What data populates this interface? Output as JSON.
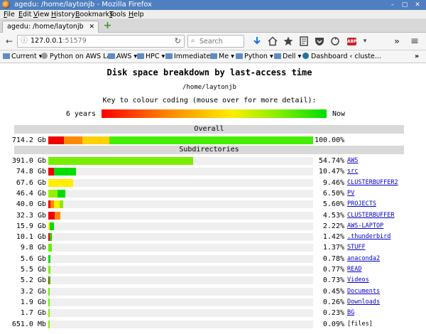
{
  "window": {
    "title": "agedu: /home/laytonjb - Mozilla Firefox",
    "minimize_glyph": "–",
    "maximize_glyph": "▢",
    "close_glyph": "✕"
  },
  "menu": {
    "items": [
      {
        "label": "File",
        "mnemonic": "F",
        "rest": "ile"
      },
      {
        "label": "Edit",
        "mnemonic": "E",
        "rest": "dit"
      },
      {
        "label": "View",
        "mnemonic": "V",
        "rest": "iew"
      },
      {
        "label": "History",
        "mnemonic": "H",
        "rest": "istory"
      },
      {
        "label": "Bookmarks",
        "mnemonic": "B",
        "rest": "ookmarks"
      },
      {
        "label": "Tools",
        "mnemonic": "T",
        "rest": "ools"
      },
      {
        "label": "Help",
        "mnemonic": "H",
        "rest": "elp"
      }
    ]
  },
  "tab": {
    "label": "agedu: /home/laytonjb",
    "close_glyph": "✕",
    "new_tab_glyph": "+"
  },
  "nav": {
    "back_glyph": "←",
    "url_host": "127.0.0.1",
    "url_port": ":51579",
    "reload_glyph": "↻",
    "search_placeholder": "Search",
    "icons": [
      "download-icon",
      "home-icon",
      "star-icon",
      "reader-icon",
      "pocket-icon",
      "sync-icon",
      "adblock-icon",
      "overflow-icon",
      "menu-icon"
    ],
    "abp_label": "ABP",
    "overflow_glyph": "»",
    "menu_glyph": "≡"
  },
  "bookmarks": {
    "items": [
      {
        "label": "Current",
        "type": "folder"
      },
      {
        "label": "Python on AWS La...",
        "type": "link"
      },
      {
        "label": "AWS",
        "type": "folder"
      },
      {
        "label": "HPC",
        "type": "folder"
      },
      {
        "label": "Immediate",
        "type": "folder"
      },
      {
        "label": "Me",
        "type": "folder"
      },
      {
        "label": "Python",
        "type": "folder"
      },
      {
        "label": "Dell",
        "type": "folder"
      },
      {
        "label": "Dashboard ‹ cluste...",
        "type": "link"
      }
    ],
    "overflow_glyph": "»"
  },
  "page": {
    "heading": "Disk space breakdown by last-access time",
    "path": "/home/laytonjb",
    "key_text": "Key to colour coding (mouse over for more detail):",
    "key_old": "6 years",
    "key_now": "Now",
    "overall_label": "Overall",
    "subdirs_label": "Subdirectories",
    "colors": {
      "red": "#ff0000",
      "orange": "#ff8800",
      "yellow": "#ffee00",
      "lime": "#88ee00",
      "green": "#00dd00",
      "link": "#0000cc",
      "section_bg": "#d9d9d9",
      "track_bg": "#efefef"
    },
    "overall": {
      "size": "714.2 Gb",
      "pct": "100.00%",
      "fraction": 1.0,
      "segments": [
        {
          "frac": 0.06,
          "color": "#ee0000"
        },
        {
          "frac": 0.07,
          "color": "#ff8800"
        },
        {
          "frac": 0.1,
          "color": "#ffd000"
        },
        {
          "frac": 0.77,
          "color": "#44ee00"
        }
      ]
    },
    "rows": [
      {
        "size": "391.0 Gb",
        "pct": "54.74%",
        "name": "AWS",
        "link": true,
        "fraction": 0.5474,
        "segments": [
          {
            "frac": 1.0,
            "color": "#77ee00"
          }
        ]
      },
      {
        "size": "74.8 Gb",
        "pct": "10.47%",
        "name": "src",
        "link": true,
        "fraction": 0.1047,
        "segments": [
          {
            "frac": 0.2,
            "color": "#ee0000"
          },
          {
            "frac": 0.8,
            "color": "#00dd00"
          }
        ]
      },
      {
        "size": "67.6 Gb",
        "pct": "9.46%",
        "name": "CLUSTERBUFFER2",
        "link": true,
        "fraction": 0.0946,
        "segments": [
          {
            "frac": 1.0,
            "color": "#ffee00"
          }
        ]
      },
      {
        "size": "46.4 Gb",
        "pct": "6.50%",
        "name": "PV",
        "link": true,
        "fraction": 0.065,
        "segments": [
          {
            "frac": 0.55,
            "color": "#99ee00"
          },
          {
            "frac": 0.45,
            "color": "#00dd00"
          }
        ]
      },
      {
        "size": "40.0 Gb",
        "pct": "5.60%",
        "name": "PROJECTS",
        "link": true,
        "fraction": 0.056,
        "segments": [
          {
            "frac": 0.12,
            "color": "#ee0000"
          },
          {
            "frac": 0.25,
            "color": "#ff8800"
          },
          {
            "frac": 0.4,
            "color": "#ffee00"
          },
          {
            "frac": 0.23,
            "color": "#88ee00"
          }
        ]
      },
      {
        "size": "32.3 Gb",
        "pct": "4.53%",
        "name": "CLUSTERBUFFER",
        "link": true,
        "fraction": 0.0453,
        "segments": [
          {
            "frac": 0.55,
            "color": "#ee0000"
          },
          {
            "frac": 0.45,
            "color": "#ff8800"
          }
        ]
      },
      {
        "size": "15.9 Gb",
        "pct": "2.22%",
        "name": "AWS-LAPTOP",
        "link": true,
        "fraction": 0.0222,
        "segments": [
          {
            "frac": 0.25,
            "color": "#ffee00"
          },
          {
            "frac": 0.75,
            "color": "#00dd00"
          }
        ]
      },
      {
        "size": "10.1 Gb",
        "pct": "1.42%",
        "name": ".thunderbird",
        "link": true,
        "fraction": 0.0142,
        "segments": [
          {
            "frac": 0.35,
            "color": "#ee0000"
          },
          {
            "frac": 0.65,
            "color": "#00dd00"
          }
        ]
      },
      {
        "size": "9.8 Gb",
        "pct": "1.37%",
        "name": "STUFF",
        "link": true,
        "fraction": 0.0137,
        "segments": [
          {
            "frac": 1.0,
            "color": "#66ee00"
          }
        ]
      },
      {
        "size": "5.6 Gb",
        "pct": "0.78%",
        "name": "anaconda2",
        "link": true,
        "fraction": 0.0078,
        "segments": [
          {
            "frac": 1.0,
            "color": "#00dd00"
          }
        ]
      },
      {
        "size": "5.5 Gb",
        "pct": "0.77%",
        "name": "READ",
        "link": true,
        "fraction": 0.0077,
        "segments": [
          {
            "frac": 1.0,
            "color": "#77ee00"
          }
        ]
      },
      {
        "size": "5.2 Gb",
        "pct": "0.73%",
        "name": "Videos",
        "link": true,
        "fraction": 0.0073,
        "segments": [
          {
            "frac": 0.5,
            "color": "#ee0000"
          },
          {
            "frac": 0.5,
            "color": "#00dd00"
          }
        ]
      },
      {
        "size": "3.2 Gb",
        "pct": "0.45%",
        "name": "Documents",
        "link": true,
        "fraction": 0.0045,
        "segments": [
          {
            "frac": 1.0,
            "color": "#66ee00"
          }
        ]
      },
      {
        "size": "1.9 Gb",
        "pct": "0.26%",
        "name": "Downloads",
        "link": true,
        "fraction": 0.0026,
        "segments": [
          {
            "frac": 1.0,
            "color": "#66ee00"
          }
        ]
      },
      {
        "size": "1.7 Gb",
        "pct": "0.23%",
        "name": "BG",
        "link": true,
        "fraction": 0.0023,
        "segments": [
          {
            "frac": 1.0,
            "color": "#88ee00"
          }
        ]
      },
      {
        "size": "651.0 Mb",
        "pct": "0.09%",
        "name": "[files]",
        "link": false,
        "fraction": 0.0009,
        "segments": [
          {
            "frac": 1.0,
            "color": "#88ee00"
          }
        ]
      }
    ]
  }
}
